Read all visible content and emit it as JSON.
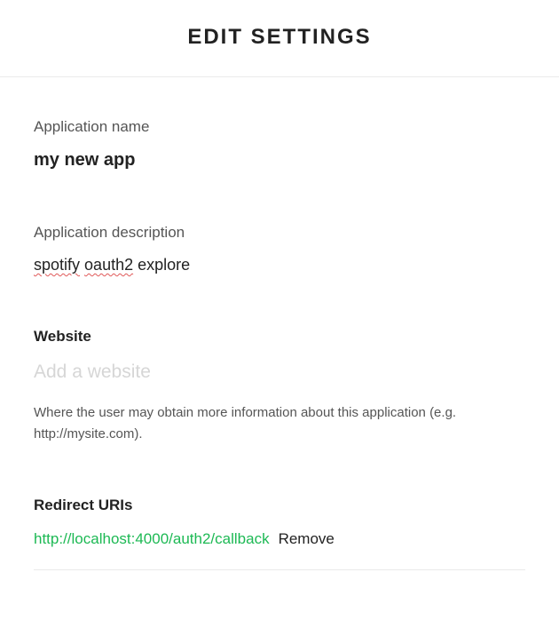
{
  "header": {
    "title": "EDIT SETTINGS"
  },
  "app_name": {
    "label": "Application name",
    "value": "my new app"
  },
  "app_description": {
    "label": "Application description",
    "word1": "spotify",
    "word2": "oauth2",
    "word3": "explore"
  },
  "website": {
    "label": "Website",
    "placeholder": "Add a website",
    "value": "",
    "help": "Where the user may obtain more information about this application (e.g. http://mysite.com)."
  },
  "redirect": {
    "label": "Redirect URIs",
    "items": [
      {
        "url": "http://localhost:4000/auth2/callback",
        "remove_label": "Remove"
      }
    ]
  }
}
